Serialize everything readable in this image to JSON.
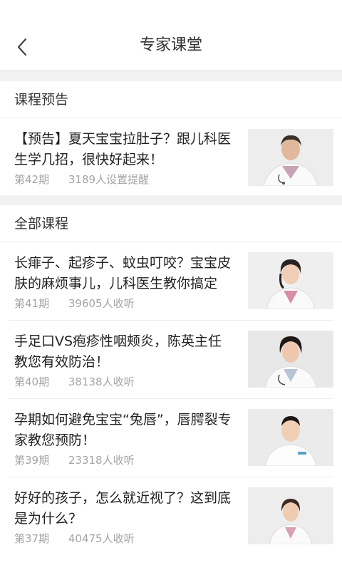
{
  "header": {
    "title": "专家课堂",
    "back_icon": "chevron-left-icon"
  },
  "preview_section": {
    "heading": "课程预告",
    "items": [
      {
        "title": "【预告】夏天宝宝拉肚子？跟儿科医生学几招，很快好起来！",
        "issue": "第42期",
        "count": "3189人设置提醒"
      }
    ]
  },
  "all_section": {
    "heading": "全部课程",
    "items": [
      {
        "title": "长痱子、起疹子、蚊虫叮咬？宝宝皮肤的麻烦事儿，儿科医生教你搞定",
        "issue": "第41期",
        "count": "39605人收听"
      },
      {
        "title": "手足口VS疱疹性咽颊炎，陈英主任教您有效防治！",
        "issue": "第40期",
        "count": "38138人收听"
      },
      {
        "title": "孕期如何避免宝宝“兔唇”，唇腭裂专家教您预防！",
        "issue": "第39期",
        "count": "23318人收听"
      },
      {
        "title": "好好的孩子，怎么就近视了？这到底是为什么？",
        "issue": "第37期",
        "count": "40475人收听"
      }
    ]
  },
  "colors": {
    "background": "#f2f2f2",
    "text_primary": "#222222",
    "text_meta": "#a5a5a5",
    "divider": "#ececec"
  }
}
